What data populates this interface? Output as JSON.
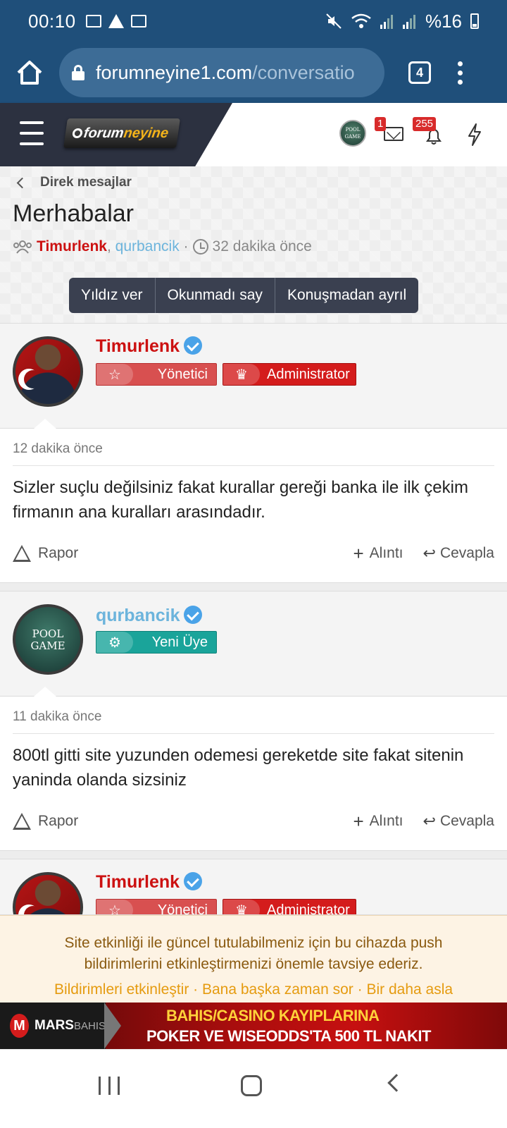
{
  "status_bar": {
    "time": "00:10",
    "battery": "%16"
  },
  "browser": {
    "url_host": "forumneyine1.com",
    "url_path": "/conversatio",
    "tab_count": "4"
  },
  "site": {
    "logo_pre": "forum",
    "logo_post": "neyine",
    "avatar_text_1": "POOL",
    "avatar_text_2": "GAME",
    "inbox_badge": "1",
    "alerts_badge": "255"
  },
  "conversation": {
    "breadcrumb": "Direk mesajlar",
    "title": "Merhabalar",
    "participant_1": "Timurlenk",
    "participant_2": "qurbancik",
    "time_ago": "32 dakika önce",
    "buttons": [
      "Yıldız ver",
      "Okunmadı say",
      "Konuşmadan ayrıl"
    ]
  },
  "messages": [
    {
      "user": "Timurlenk",
      "banner_1": "Yönetici",
      "banner_2": "Administrator",
      "time": "12 dakika önce",
      "text": "Sizler suçlu değilsiniz fakat kurallar gereği banka ile ilk çekim firmanın ana kuralları arasındadır.",
      "report": "Rapor",
      "quote": "Alıntı",
      "reply": "Cevapla"
    },
    {
      "user": "qurbancik",
      "banner_1": "Yeni Üye",
      "avatar_text_1": "POOL",
      "avatar_text_2": "GAME",
      "time": "11 dakika önce",
      "text": "800tl gitti site yuzunden odemesi gereketde site fakat sitenin yaninda olanda sizsiniz",
      "report": "Rapor",
      "quote": "Alıntı",
      "reply": "Cevapla"
    },
    {
      "user": "Timurlenk",
      "banner_1": "Yönetici",
      "banner_2": "Administrator"
    }
  ],
  "push_notice": {
    "text": "Site etkinliği ile güncel tutulabilmeniz için bu cihazda push bildirimlerini etkinleştirmenizi önemle tavsiye ederiz.",
    "enable": "Bildirimleri etkinleştir",
    "later": "Bana başka zaman sor",
    "never": "Bir daha asla",
    "sep": " · "
  },
  "ad": {
    "brand_1": "MARS",
    "brand_2": "BAHIS",
    "line_1": "BAHIS/CASINO KAYIPLARINA",
    "line_2": "POKER VE WISEODDS'TA 500 TL NAKIT"
  },
  "colors": {
    "browser_bar": "#1f4f7a",
    "admin_name": "#cc1111",
    "member_name": "#6cb4dc",
    "notice_text": "#8a5a10",
    "notice_link": "#e59b10"
  }
}
